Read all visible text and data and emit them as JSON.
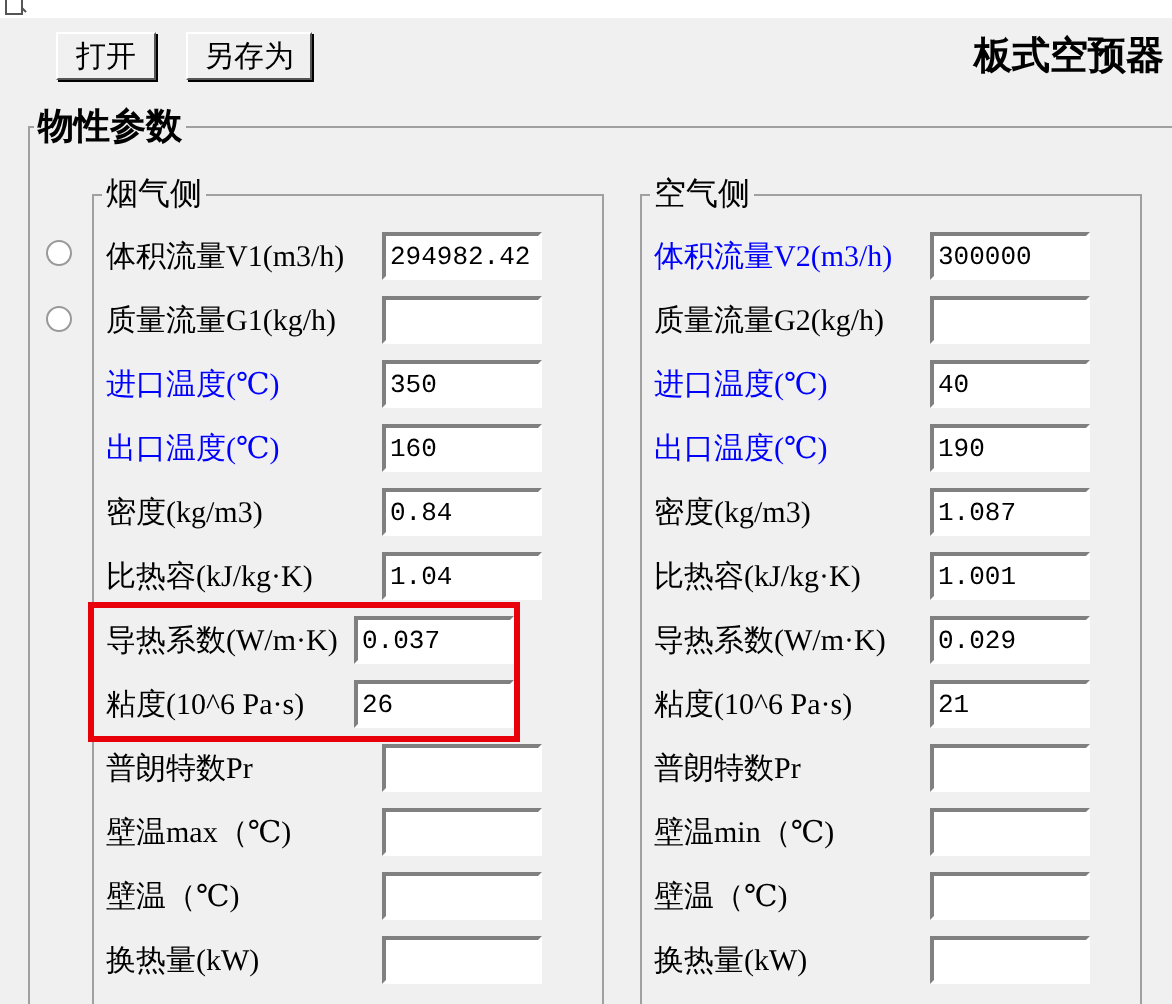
{
  "toolbar": {
    "buttons": [
      "打开",
      "另存为"
    ],
    "title": "板式空预器"
  },
  "section": {
    "title": "物性参数",
    "groups": [
      {
        "title": "烟气侧",
        "rows": [
          {
            "label": "体积流量V1(m3/h)",
            "value": "294982.42",
            "emphasized": false,
            "highlighted": false,
            "radio": {
              "selected": false
            }
          },
          {
            "label": "质量流量G1(kg/h)",
            "emphasized": false,
            "highlighted": false,
            "radio": {
              "selected": false
            }
          },
          {
            "label": "进口温度(℃)",
            "value": "350",
            "emphasized": true,
            "highlighted": false
          },
          {
            "label": "出口温度(℃)",
            "value": "160",
            "emphasized": true,
            "highlighted": false
          },
          {
            "label": "密度(kg/m3)",
            "value": "0.84",
            "emphasized": false,
            "highlighted": false
          },
          {
            "label": "比热容(kJ/kg·K)",
            "value": "1.04",
            "emphasized": false,
            "highlighted": false
          },
          {
            "label": "导热系数(W/m·K)",
            "value": "0.037",
            "emphasized": false,
            "highlighted": true
          },
          {
            "label": "粘度(10^6 Pa·s)",
            "value": "26",
            "emphasized": false,
            "highlighted": true
          },
          {
            "label": "普朗特数Pr",
            "emphasized": false,
            "highlighted": false
          },
          {
            "label": "壁温max（℃)",
            "emphasized": false,
            "highlighted": false
          },
          {
            "label": "壁温（℃)",
            "emphasized": false,
            "highlighted": false
          },
          {
            "label": "换热量(kW)",
            "emphasized": false,
            "highlighted": false
          }
        ]
      },
      {
        "title": "空气侧",
        "rows": [
          {
            "label": "体积流量V2(m3/h)",
            "value": "300000",
            "emphasized": true,
            "highlighted": false
          },
          {
            "label": "质量流量G2(kg/h)",
            "emphasized": false,
            "highlighted": false
          },
          {
            "label": "进口温度(℃)",
            "value": "40",
            "emphasized": true,
            "highlighted": false
          },
          {
            "label": "出口温度(℃)",
            "value": "190",
            "emphasized": true,
            "highlighted": false
          },
          {
            "label": "密度(kg/m3)",
            "value": "1.087",
            "emphasized": false,
            "highlighted": false
          },
          {
            "label": "比热容(kJ/kg·K)",
            "value": "1.001",
            "emphasized": false,
            "highlighted": false
          },
          {
            "label": "导热系数(W/m·K)",
            "value": "0.029",
            "emphasized": false,
            "highlighted": false
          },
          {
            "label": "粘度(10^6 Pa·s)",
            "value": "21",
            "emphasized": false,
            "highlighted": false
          },
          {
            "label": "普朗特数Pr",
            "emphasized": false,
            "highlighted": false
          },
          {
            "label": "壁温min（℃)",
            "emphasized": false,
            "highlighted": false
          },
          {
            "label": "壁温（℃)",
            "emphasized": false,
            "highlighted": false
          },
          {
            "label": "换热量(kW)",
            "emphasized": false,
            "highlighted": false
          }
        ]
      }
    ]
  }
}
